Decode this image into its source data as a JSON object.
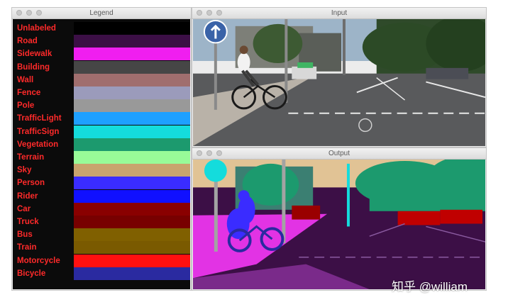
{
  "windows": {
    "legend": {
      "title": "Legend"
    },
    "input": {
      "title": "Input"
    },
    "output": {
      "title": "Output"
    }
  },
  "legend_items": [
    {
      "label": "Unlabeled",
      "color": "#000000"
    },
    {
      "label": "Road",
      "color": "#3c0f46"
    },
    {
      "label": "Sidewalk",
      "color": "#f01ef0"
    },
    {
      "label": "Building",
      "color": "#464646"
    },
    {
      "label": "Wall",
      "color": "#a06e6e"
    },
    {
      "label": "Fence",
      "color": "#9b9bbb"
    },
    {
      "label": "Pole",
      "color": "#999999"
    },
    {
      "label": "TrafficLight",
      "color": "#1ea0ff"
    },
    {
      "label": "TrafficSign",
      "color": "#14dcdc"
    },
    {
      "label": "Vegetation",
      "color": "#1c9a6e"
    },
    {
      "label": "Terrain",
      "color": "#98fb98"
    },
    {
      "label": "Sky",
      "color": "#c8a46e"
    },
    {
      "label": "Person",
      "color": "#3a2cff"
    },
    {
      "label": "Rider",
      "color": "#1010ff"
    },
    {
      "label": "Car",
      "color": "#8a0000"
    },
    {
      "label": "Truck",
      "color": "#780000"
    },
    {
      "label": "Bus",
      "color": "#806000"
    },
    {
      "label": "Train",
      "color": "#7a5a00"
    },
    {
      "label": "Motorcycle",
      "color": "#ff1010"
    },
    {
      "label": "Bicycle",
      "color": "#2a2aa0"
    }
  ],
  "watermark": "知乎 @william"
}
